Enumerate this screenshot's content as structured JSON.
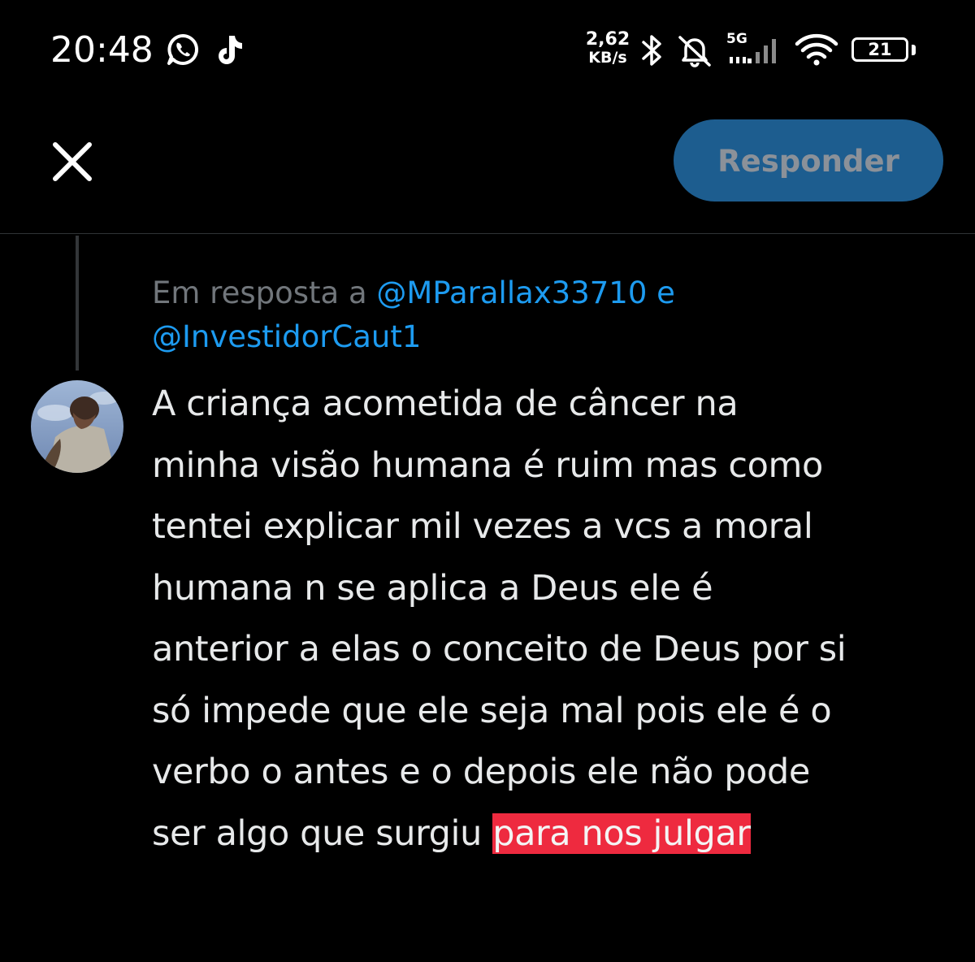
{
  "status_bar": {
    "time": "20:48",
    "net_speed_value": "2,62",
    "net_speed_unit": "KB/s",
    "network_type": "5G",
    "battery_level": "21",
    "battery_fraction": 0.21,
    "icons": [
      "whatsapp-icon",
      "tiktok-icon",
      "bluetooth-icon",
      "mute-icon",
      "signal-icon",
      "wifi-icon",
      "battery-icon"
    ]
  },
  "header": {
    "close_icon": "close-icon",
    "reply_button_label": "Responder"
  },
  "reply_context": {
    "prefix": "Em resposta a",
    "mention_1": "@MParallax33710",
    "conjunction": "e",
    "mention_2": "@InvestidorCaut1"
  },
  "tweet": {
    "lines": [
      "A criança acometida de câncer na",
      "minha visão humana é ruim mas como",
      "tentei explicar mil vezes a vcs a moral",
      "humana n se aplica a Deus ele é",
      "anterior a elas o conceito de Deus por si",
      "só impede que ele seja mal pois ele é o",
      "verbo o antes e o depois ele não pode",
      "ser algo que surgiu "
    ],
    "highlighted": "para nos julgar",
    "highlight_color": "#ee2a3f"
  },
  "colors": {
    "background": "#000000",
    "accent": "#1d9bf0",
    "reply_button_bg": "#1d5d8f",
    "muted_text": "#71767b"
  }
}
